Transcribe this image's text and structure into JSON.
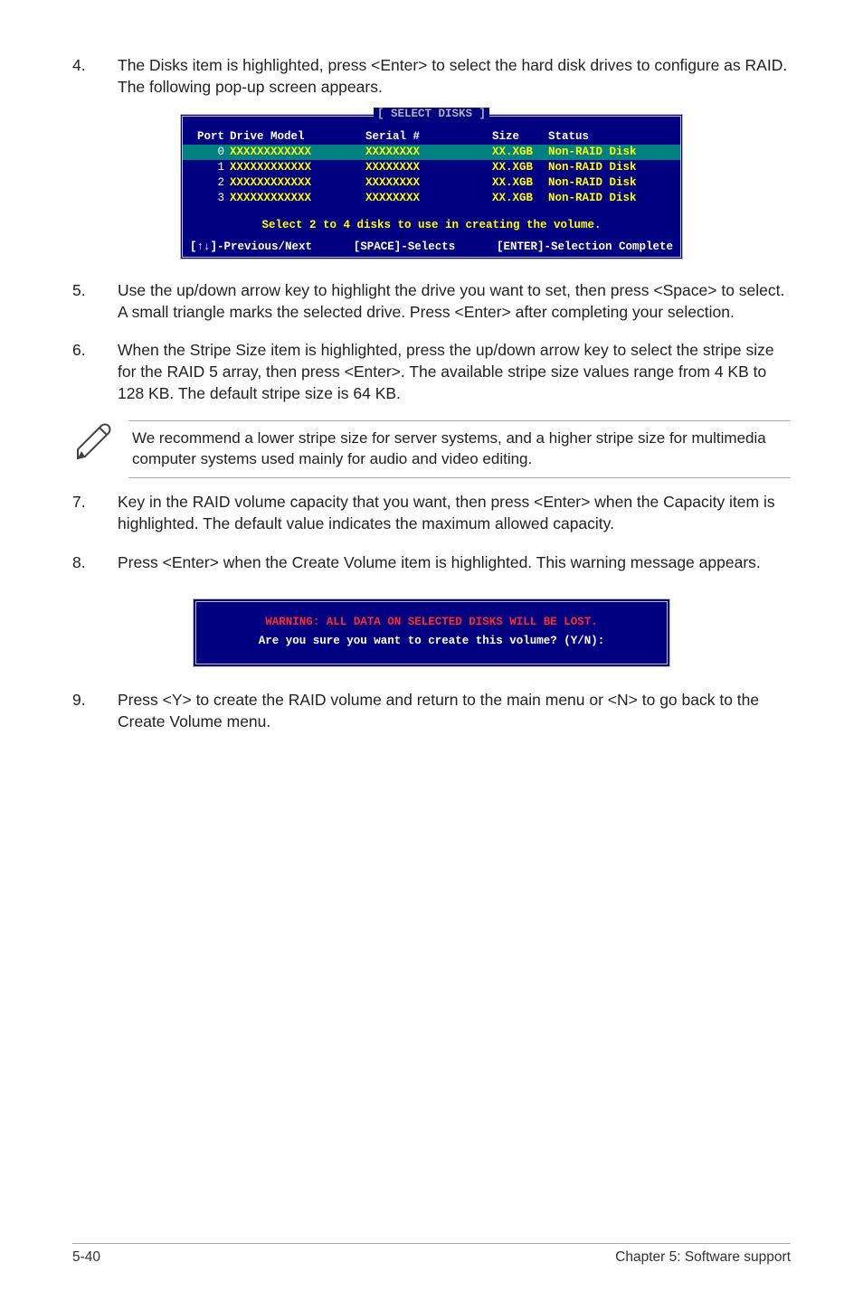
{
  "steps": {
    "s4": {
      "num": "4.",
      "text": "The Disks item is highlighted, press <Enter> to select the hard disk drives to configure as RAID. The following pop-up screen appears."
    },
    "s5": {
      "num": "5.",
      "text": "Use the up/down arrow key to highlight the drive you want to set, then press <Space> to select. A small triangle marks the selected drive. Press <Enter> after completing your selection."
    },
    "s6": {
      "num": "6.",
      "text": "When the Stripe Size item is highlighted, press the up/down arrow key to select the stripe size for the RAID 5 array, then press <Enter>. The available stripe size values range from 4 KB to 128 KB. The default stripe size is 64 KB."
    },
    "s7": {
      "num": "7.",
      "text": "Key in the RAID volume capacity that you want, then press <Enter> when the Capacity item is highlighted. The default value indicates the maximum allowed capacity."
    },
    "s8": {
      "num": "8.",
      "text": "Press <Enter> when the Create Volume item is highlighted. This warning message appears."
    },
    "s9": {
      "num": "9.",
      "text": "Press <Y> to create the RAID volume and return to the main menu or <N> to go back to the Create Volume menu."
    }
  },
  "note": "We recommend a lower stripe size for server systems, and a higher stripe size for multimedia computer systems used mainly for audio and video editing.",
  "term": {
    "title": "[ SELECT DISKS ]",
    "headers": {
      "port": "Port",
      "model": "Drive Model",
      "serial": "Serial #",
      "size": "Size",
      "status": "Status"
    },
    "rows": [
      {
        "port": "0",
        "model": "XXXXXXXXXXXX",
        "serial": "XXXXXXXX",
        "size": "XX.XGB",
        "status": "Non-RAID Disk",
        "selected": true
      },
      {
        "port": "1",
        "model": "XXXXXXXXXXXX",
        "serial": "XXXXXXXX",
        "size": "XX.XGB",
        "status": "Non-RAID Disk",
        "selected": false
      },
      {
        "port": "2",
        "model": "XXXXXXXXXXXX",
        "serial": "XXXXXXXX",
        "size": "XX.XGB",
        "status": "Non-RAID Disk",
        "selected": false
      },
      {
        "port": "3",
        "model": "XXXXXXXXXXXX",
        "serial": "XXXXXXXX",
        "size": "XX.XGB",
        "status": "Non-RAID Disk",
        "selected": false
      }
    ],
    "info": "Select 2 to 4 disks to use in creating the volume.",
    "footer": {
      "left": "[↑↓]-Previous/Next",
      "mid": "[SPACE]-Selects",
      "right": "[ENTER]-Selection Complete"
    }
  },
  "warn": {
    "line1": "WARNING: ALL DATA ON SELECTED DISKS WILL BE LOST.",
    "line2": "Are you sure you want to create this volume? (Y/N):"
  },
  "footer": {
    "left": "5-40",
    "right": "Chapter 5: Software support"
  }
}
